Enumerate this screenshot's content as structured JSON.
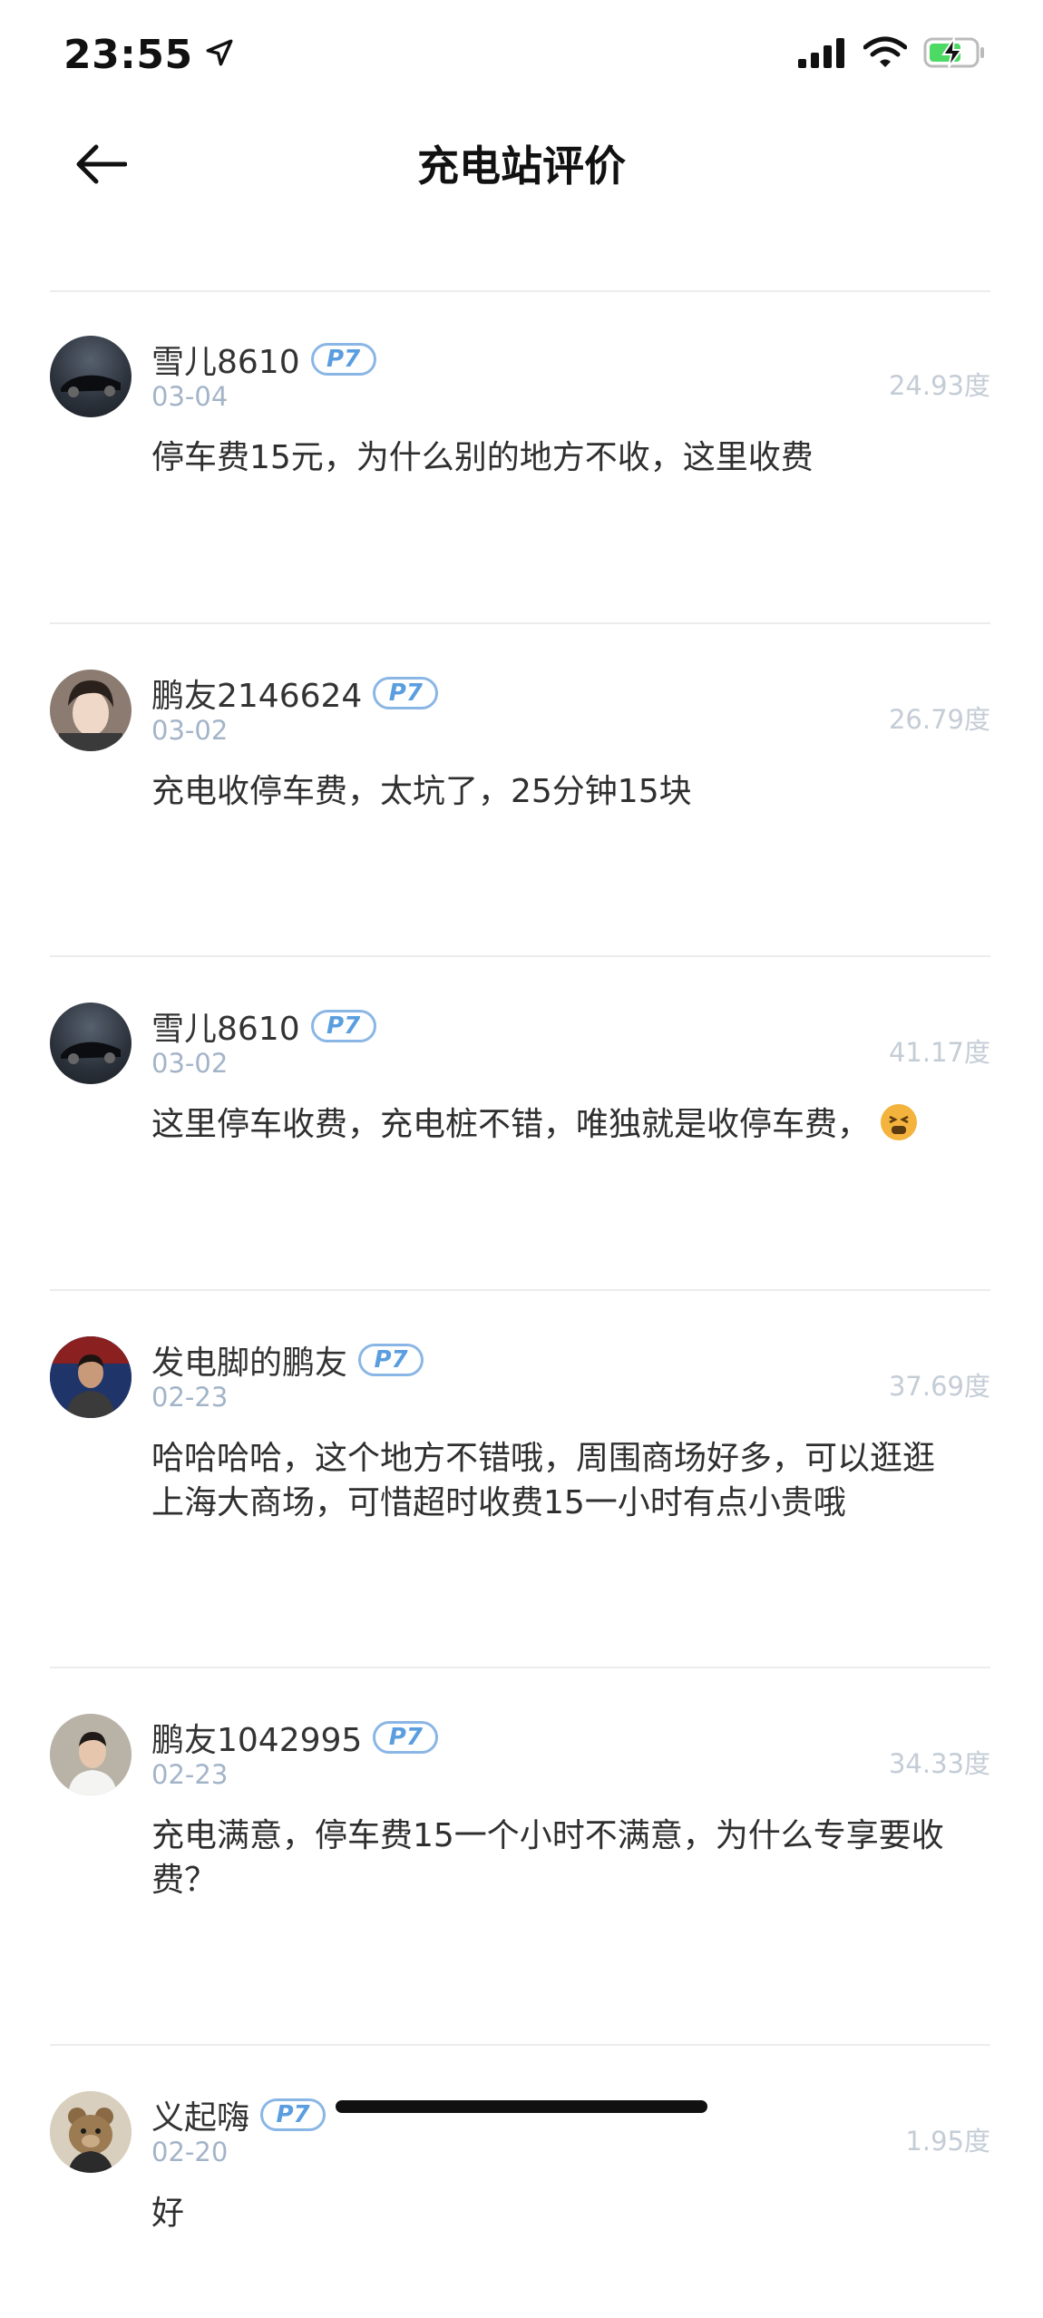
{
  "status_bar": {
    "time": "23:55"
  },
  "nav": {
    "title": "充电站评价"
  },
  "reviews": [
    {
      "username": "雪儿8610",
      "badge": "P7",
      "date": "03-04",
      "kwh": "24.93度",
      "content": "停车费15元，为什么别的地方不收，这里收费"
    },
    {
      "username": "鹏友2146624",
      "badge": "P7",
      "date": "03-02",
      "kwh": "26.79度",
      "content": "充电收停车费，太坑了，25分钟15块"
    },
    {
      "username": "雪儿8610",
      "badge": "P7",
      "date": "03-02",
      "kwh": "41.17度",
      "content": "这里停车收费，充电桩不错，唯独就是收停车费，"
    },
    {
      "username": "发电脚的鹏友",
      "badge": "P7",
      "date": "02-23",
      "kwh": "37.69度",
      "content": "哈哈哈哈，这个地方不错哦，周围商场好多，可以逛逛上海大商场，可惜超时收费15一小时有点小贵哦"
    },
    {
      "username": "鹏友1042995",
      "badge": "P7",
      "date": "02-23",
      "kwh": "34.33度",
      "content": "充电满意，停车费15一个小时不满意，为什么专享要收费？"
    },
    {
      "username": "义起嗨",
      "badge": "P7",
      "date": "02-20",
      "kwh": "1.95度",
      "content": "好"
    }
  ],
  "icons": {
    "back": "arrow-left-icon",
    "location": "location-arrow-icon",
    "signal": "cellular-signal-icon",
    "wifi": "wifi-icon",
    "battery": "battery-charging-icon"
  },
  "colors": {
    "badge": "#5a9ee0",
    "date": "#a3b4c8",
    "kwh": "#c4ccd6",
    "battery": "#4cd964"
  }
}
